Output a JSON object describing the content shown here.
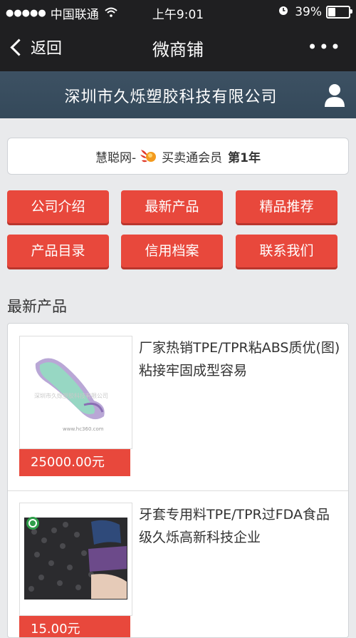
{
  "status": {
    "signal_dots": "●●●●●",
    "carrier": "中国联通",
    "time": "上午9:01",
    "battery_text": "39%",
    "battery_level": 0.39
  },
  "nav": {
    "back_label": "返回",
    "title": "微商铺",
    "more_label": "•••"
  },
  "company": {
    "name": "深圳市久烁塑胶科技有限公司"
  },
  "member": {
    "prefix": "慧聪网-",
    "label": "买卖通会员",
    "years": "第1年"
  },
  "buttons": [
    {
      "label": "公司介绍"
    },
    {
      "label": "最新产品"
    },
    {
      "label": "精品推荐"
    },
    {
      "label": "产品目录"
    },
    {
      "label": "信用档案"
    },
    {
      "label": "联系我们"
    }
  ],
  "section": {
    "title": "最新产品"
  },
  "products": [
    {
      "title": "厂家热销TPE/TPR粘ABS质优(图)粘接牢固成型容易",
      "price": "25000.00元",
      "image_watermark": "深圳市久烁塑胶科技有限公司",
      "image_url_text": "www.hc360.com"
    },
    {
      "title": "牙套专用料TPE/TPR过FDA食品级久烁高新科技企业",
      "price": "15.00元"
    }
  ],
  "colors": {
    "accent_red": "#e8483c",
    "header_dark": "#1f1f21",
    "company_bar": "#3d5163"
  }
}
